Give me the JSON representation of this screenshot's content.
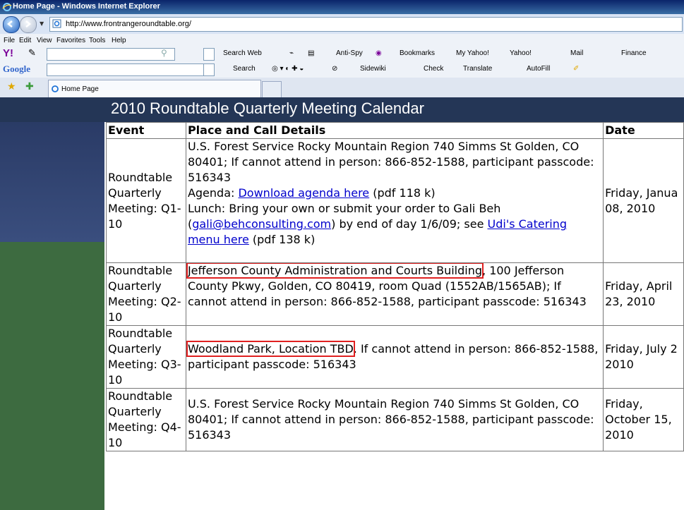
{
  "window": {
    "title": "Home Page - Windows Internet Explorer"
  },
  "address": {
    "url": "http://www.frontrangeroundtable.org/"
  },
  "menubar": [
    "File",
    "Edit",
    "View",
    "Favorites",
    "Tools",
    "Help"
  ],
  "yahoo_toolbar": {
    "search_btn": "Search Web",
    "items": [
      "Anti-Spy",
      "Bookmarks",
      "My Yahoo!",
      "Yahoo!",
      "Mail",
      "Finance"
    ]
  },
  "google_toolbar": {
    "logo": "Google",
    "items": [
      "Search",
      "Sidewiki",
      "Check",
      "Translate",
      "AutoFill"
    ]
  },
  "tab": {
    "label": "Home Page"
  },
  "page": {
    "title": "2010 Roundtable Quarterly Meeting Calendar",
    "headers": {
      "event": "Event",
      "place": "Place and Call Details",
      "date": "Date"
    },
    "rows": [
      {
        "event": "Roundtable Quarterly Meeting: Q1-10",
        "place1": "U.S. Forest Service Rocky Mountain Region 740 Simms St Golden, CO 80401; If cannot attend in person: 866-852-1588, participant passcode: 516343",
        "agenda_prefix": "Agenda: ",
        "agenda_link": "Download agenda here",
        "agenda_suffix": " (pdf 118 k)",
        "lunch_prefix": "Lunch: Bring your own or submit your order to Gali Beh (",
        "email_link": "gali@behconsulting.com",
        "lunch_mid": ") by end of day 1/6/09; see ",
        "menu_link": "Udi's Catering menu here",
        "lunch_suffix": " (pdf 138 k)",
        "date": "Friday, Janua 08, 2010"
      },
      {
        "event": "Roundtable Quarterly Meeting: Q2-10",
        "place_highlight": "Jefferson County Administration and Courts Building",
        "place_rest": ", 100 Jefferson County Pkwy, Golden, CO 80419, room Quad (1552AB/1565AB); If cannot attend in person: 866-852-1588, participant passcode: 516343",
        "date": "Friday, April 23, 2010"
      },
      {
        "event": "Roundtable Quarterly Meeting: Q3-10",
        "place_highlight": "Woodland Park, Location TBD",
        "place_rest": ". If cannot attend in person: 866-852-1588, participant passcode: 516343",
        "date": "Friday, July 2 2010"
      },
      {
        "event": "Roundtable Quarterly Meeting: Q4-10",
        "place": "U.S. Forest Service Rocky Mountain Region 740 Simms St Golden, CO 80401; If cannot attend in person: 866-852-1588, participant passcode: 516343",
        "date": "Friday, October 15, 2010"
      }
    ]
  },
  "colors": {
    "header_band": "#243656",
    "left_band_top": "#2a3b66",
    "left_band_bottom": "#3d6b40",
    "highlight_box": "#e02020",
    "link": "#0000cc"
  }
}
